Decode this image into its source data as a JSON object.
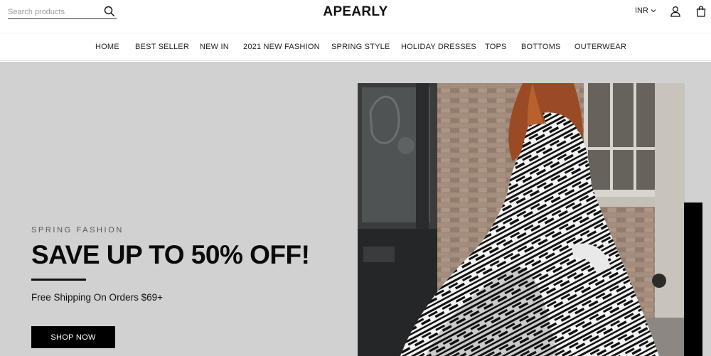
{
  "header": {
    "search_placeholder": "Search products",
    "logo": "APEARLY",
    "currency": "INR"
  },
  "icons": {
    "search": "search-icon",
    "currency_dropdown": "chevron-down-icon",
    "account": "user-icon",
    "cart": "shopping-bag-icon"
  },
  "nav": {
    "items": [
      "HOME",
      "BEST SELLER",
      "NEW IN",
      "2021 NEW FASHION",
      "SPRING STYLE",
      "HOLIDAY DRESSES",
      "TOPS",
      "BOTTOMS",
      "OUTERWEAR"
    ]
  },
  "hero": {
    "eyebrow": "SPRING FASHION",
    "headline": "SAVE UP TO 50% OFF!",
    "subtext": "Free Shipping On Orders $69+",
    "cta_label": "SHOP NOW",
    "background_color": "#d1d1d1"
  },
  "colors": {
    "text": "#111111",
    "cta_background": "#000000",
    "cta_text": "#ffffff"
  }
}
